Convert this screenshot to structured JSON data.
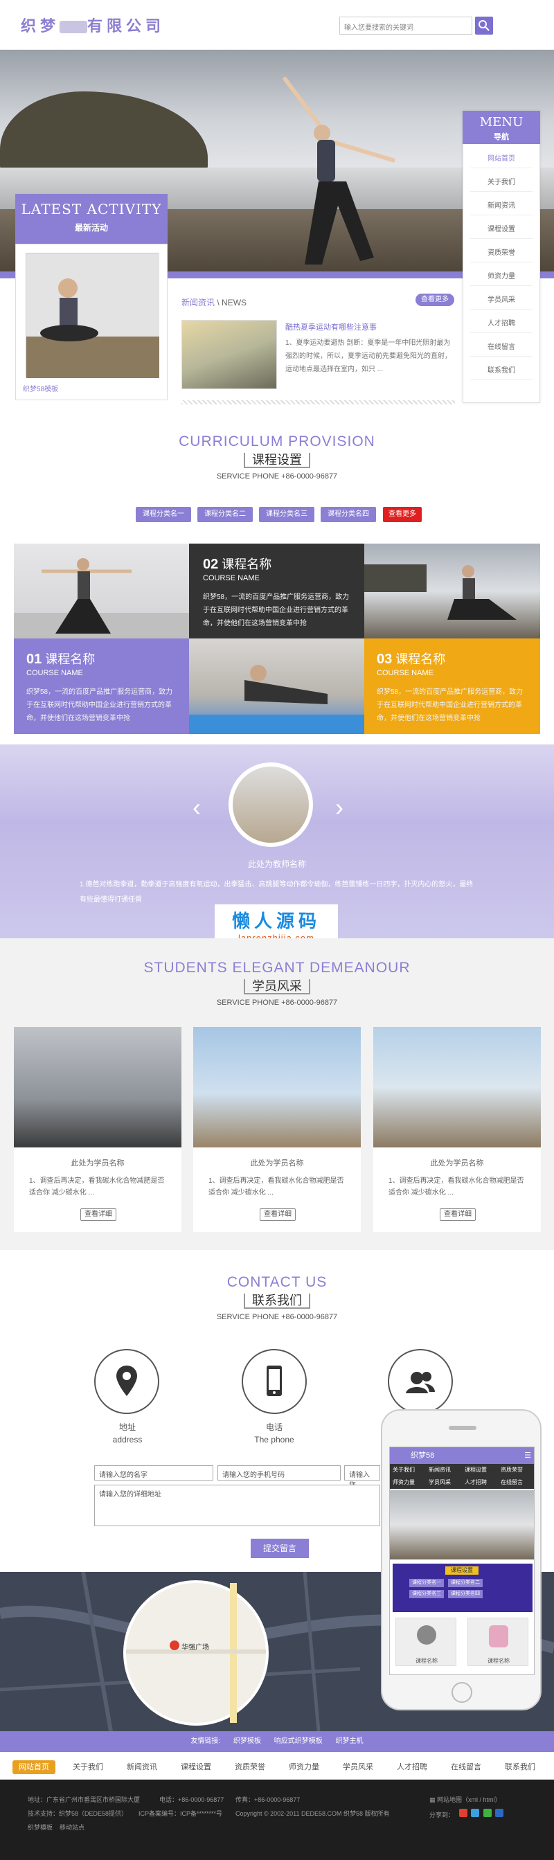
{
  "header": {
    "logo_a": "织梦",
    "logo_b": "有限公司",
    "search_placeholder": "输入您要搜索的关键词"
  },
  "latest": {
    "title_en": "LATEST ACTIVITY",
    "title_cn": "最新活动",
    "caption": "织梦58模板"
  },
  "news": {
    "tab_cn": "新闻资讯",
    "tab_en": "\\ NEWS",
    "more": "查看更多",
    "title": "酷热夏季运动有哪些注意事",
    "body": "1、夏季运动要避热 剖断：夏季是一年中阳光照射最为强烈的时候，所以，夏季运动前先要避免阳光的直射，运动地点最选择在室内，如只 ..."
  },
  "menu": {
    "title_en": "MENU",
    "title_cn": "导航",
    "items": [
      "网站首页",
      "关于我们",
      "新闻资讯",
      "课程设置",
      "资质荣誉",
      "师资力量",
      "学员风采",
      "人才招聘",
      "在线留言",
      "联系我们"
    ]
  },
  "curriculum": {
    "title_en": "CURRICULUM PROVISION",
    "title_cn": "课程设置",
    "phone": "SERVICE PHONE +86-0000-96877",
    "cats": [
      "课程分类名一",
      "课程分类名二",
      "课程分类名三",
      "课程分类名四",
      "查看更多"
    ],
    "courses": [
      {
        "num": "01",
        "name": "课程名称",
        "en": "COURSE NAME",
        "desc": "织梦58，一流的百度产品推广服务运营商，致力于在互联网时代帮助中国企业进行营销方式的革命，并使他们在这场营销变革中抢"
      },
      {
        "num": "02",
        "name": "课程名称",
        "en": "COURSE NAME",
        "desc": "织梦58，一流的百度产品推广服务运营商，致力于在互联网时代帮助中国企业进行营销方式的革命，并使他们在这场营销变革中抢"
      },
      {
        "num": "03",
        "name": "课程名称",
        "en": "COURSE NAME",
        "desc": "织梦58，一流的百度产品推广服务运营商，致力于在互联网时代帮助中国企业进行营销方式的革命，并使他们在这场营销变革中抢"
      }
    ]
  },
  "teacher": {
    "name": "此处为教师名称",
    "desc": "1.德芭对练跑拳道，勤拳道于高强度有氧运动，出拳猛击、高跳腿等动作都令瑜伽，练芭蕾锤练一日四字，扑灭内心的怒火，最终有些最懂得打通任督"
  },
  "watermark": {
    "cn": "懒人源码",
    "en": "lanrenzhijia.com"
  },
  "students": {
    "title_en": "STUDENTS ELEGANT DEMEANOUR",
    "title_cn": "学员风采",
    "phone": "SERVICE PHONE +86-0000-96877",
    "items": [
      {
        "name": "此处为学员名称",
        "desc": "1、调查后再决定，看我碳水化合物减肥是否适合你 减少碳水化 ...",
        "btn": "查看详细"
      },
      {
        "name": "此处为学员名称",
        "desc": "1、调查后再决定，看我碳水化合物减肥是否适合你 减少碳水化 ...",
        "btn": "查看详细"
      },
      {
        "name": "此处为学员名称",
        "desc": "1、调查后再决定，看我碳水化合物减肥是否适合你 减少碳水化 ...",
        "btn": "查看详细"
      }
    ]
  },
  "contact": {
    "title_en": "CONTACT US",
    "title_cn": "联系我们",
    "phone": "SERVICE PHONE +86-0000-96877",
    "address_cn": "地址",
    "address_en": "address",
    "tel_cn": "电话",
    "tel_en": "The phone",
    "name_ph": "请输入您的名字",
    "mobile_ph": "请输入您的手机号码",
    "addr_ph": "请输入您",
    "detail_ph": "请输入您的详细地址",
    "submit": "提交留言"
  },
  "map": {
    "place": "华强广场"
  },
  "mobile": {
    "title": "织梦58",
    "nav": [
      "关于我们",
      "新闻资讯",
      "课程设置",
      "资质荣誉",
      "师资力量",
      "学员风采",
      "人才招聘",
      "在线留言"
    ],
    "course_title": "课程设置",
    "cats": [
      "课程分类名一",
      "课程分类名二",
      "课程分类名三",
      "课程分类名四"
    ],
    "prod": [
      "课程名称",
      "课程名称"
    ]
  },
  "links": {
    "label": "友情链接:",
    "items": [
      "织梦模板",
      "响应式织梦模板",
      "织梦主机"
    ]
  },
  "footnav": [
    "网站首页",
    "关于我们",
    "新闻资讯",
    "课程设置",
    "资质荣誉",
    "师资力量",
    "学员风采",
    "人才招聘",
    "在线留言",
    "联系我们"
  ],
  "footer": {
    "line1": "地址：广东省广州市番禺区市桥国际大厦",
    "phone": "电话：+86-0000-96877",
    "fax": "传真：+86-0000-96877",
    "support": "技术支持：织梦58（DEDE58提供）",
    "icp": "ICP备案编号：ICP备********号",
    "copyright": "Copyright © 2002-2011 DEDE58.COM 织梦58 版权所有",
    "sitemap": "网站地图（xml / html）",
    "share": "分享到：",
    "tpl": "织梦模板",
    "mobile_site": "移动站点"
  }
}
